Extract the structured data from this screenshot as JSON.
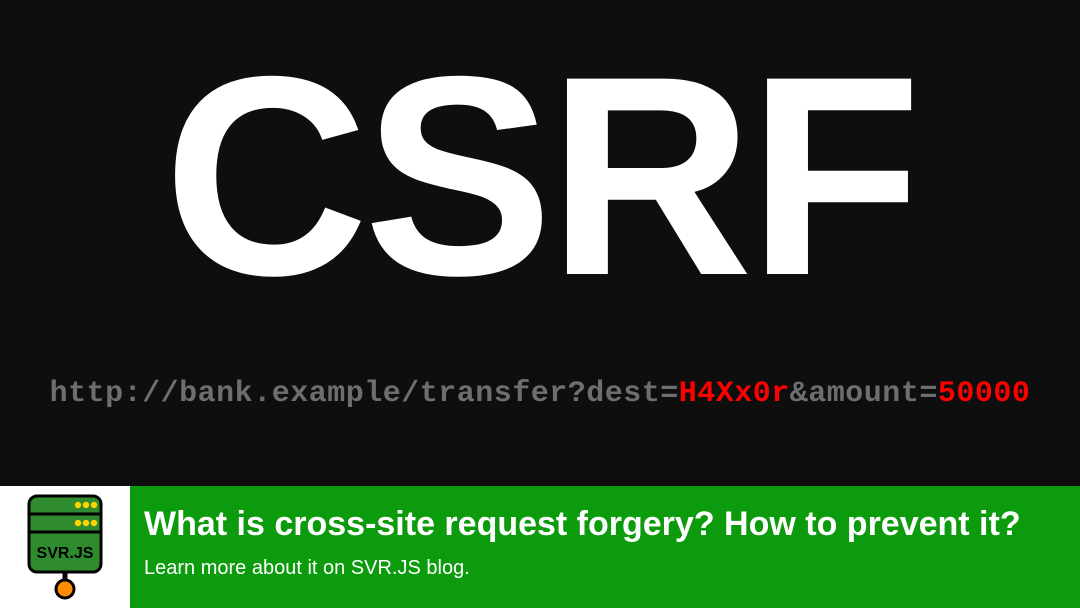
{
  "main": {
    "heading": "CSRF",
    "url": {
      "prefix": "http://bank.example/transfer?dest=",
      "dest_value": "H4Xx0r",
      "amount_label": "&amount=",
      "amount_value": "50000"
    }
  },
  "footer": {
    "logo_label": "SVR.JS",
    "title": "What is cross-site request forgery? How to prevent it?",
    "subtitle": "Learn more about it on SVR.JS blog."
  },
  "colors": {
    "bg_dark": "#0e0e0e",
    "url_gray": "#6e6e6e",
    "highlight_red": "#ff0000",
    "footer_green": "#0c9b0c",
    "logo_server": "#2e8b2e",
    "logo_orange": "#ff8c00"
  }
}
